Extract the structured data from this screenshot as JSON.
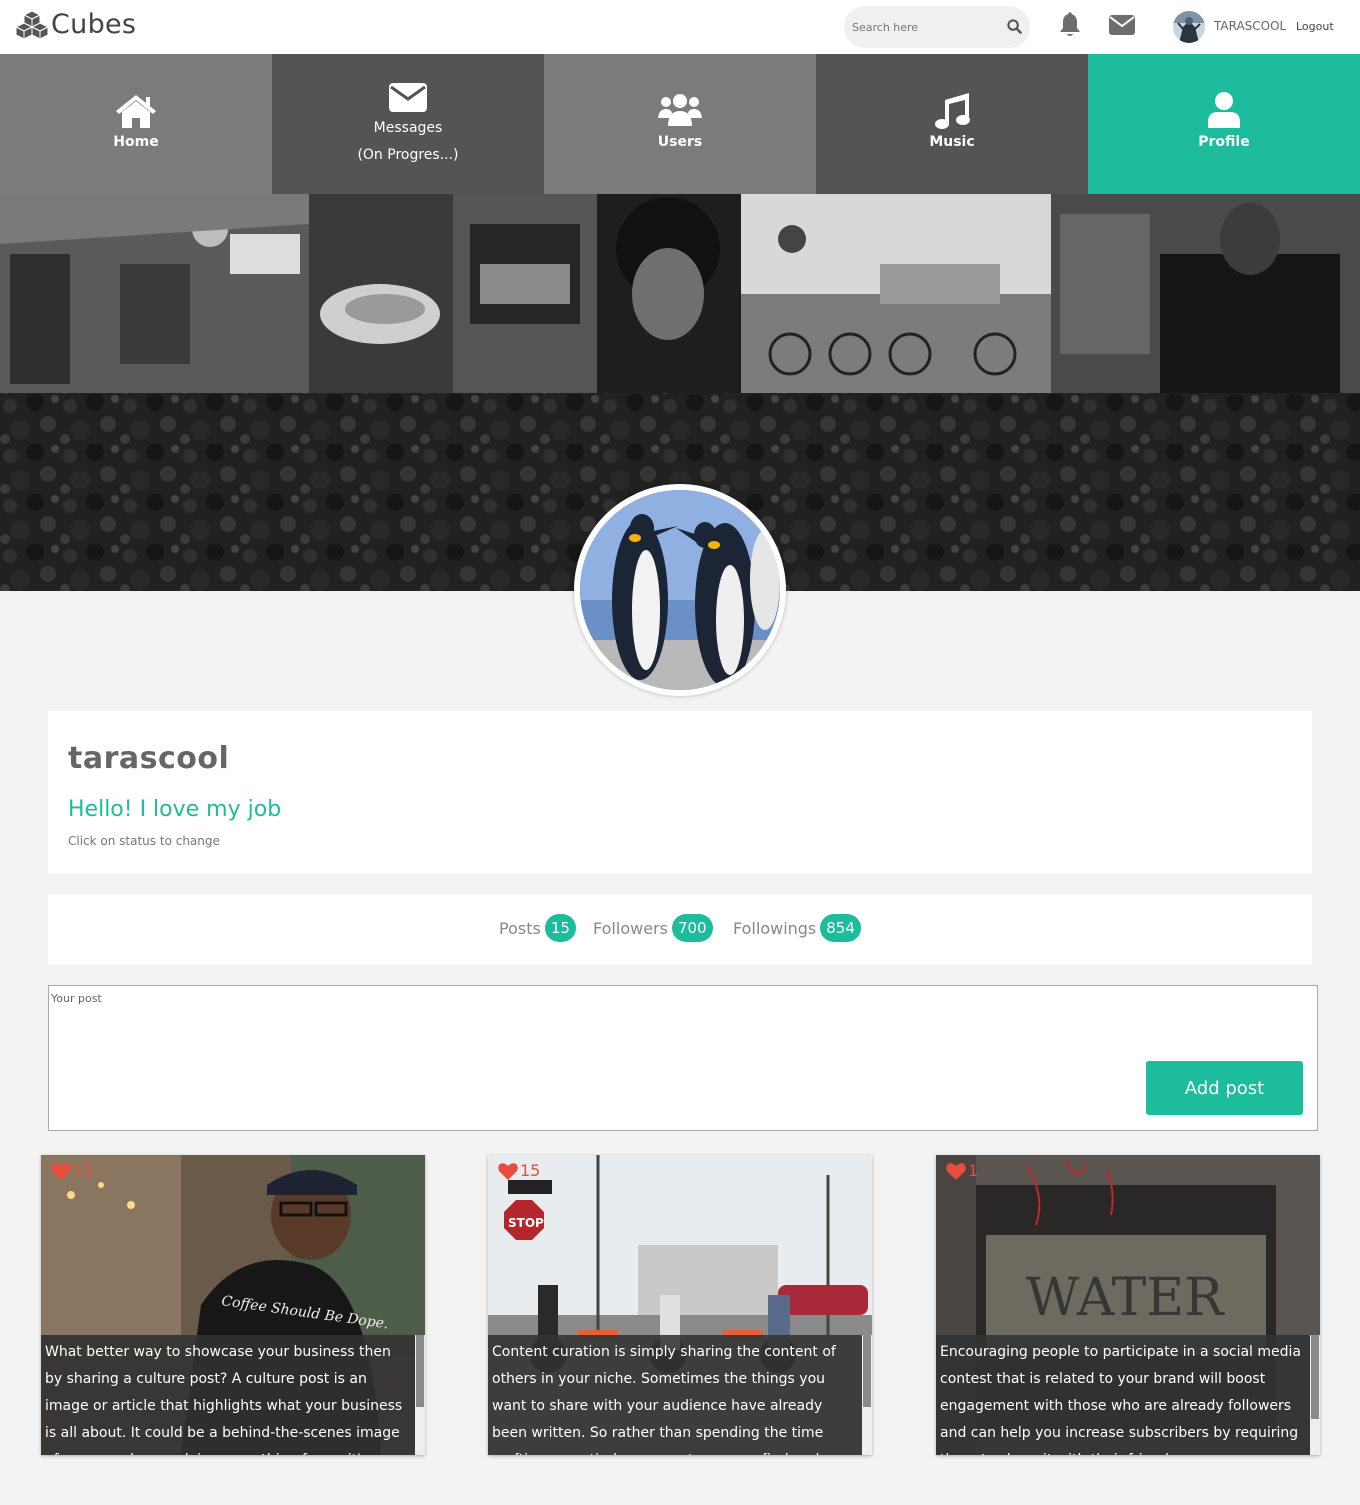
{
  "app": {
    "name": "Cubes"
  },
  "header": {
    "search_placeholder": "Search here",
    "username": "TARASCOOL",
    "logout_label": "Logout"
  },
  "nav": [
    {
      "label": "Home",
      "sub": "",
      "icon": "home-icon",
      "color": "#7b7b7b",
      "active": false
    },
    {
      "label": "Messages",
      "sub": "(On Progres...)",
      "icon": "envelope-icon",
      "color": "#545454",
      "active": false
    },
    {
      "label": "Users",
      "sub": "",
      "icon": "users-icon",
      "color": "#7b7b7b",
      "active": false
    },
    {
      "label": "Music",
      "sub": "",
      "icon": "music-icon",
      "color": "#545454",
      "active": false
    },
    {
      "label": "Profile",
      "sub": "",
      "icon": "user-icon",
      "color": "#1cbc9c",
      "active": true
    }
  ],
  "profile": {
    "username": "tarascool",
    "status": "Hello! I love my job",
    "status_hint": "Click on status to change"
  },
  "stats": {
    "posts_label": "Posts",
    "posts": "15",
    "followers_label": "Followers",
    "followers": "700",
    "followings_label": "Followings",
    "followings": "854"
  },
  "composer": {
    "placeholder": "Your post",
    "button": "Add post"
  },
  "posts": [
    {
      "likes": "12",
      "text": "What better way to showcase your business then by sharing a culture post? A culture post is an image or article that highlights what your business is all about. It could be a behind-the-scenes image of your employees doing something fun or it's a great way to humanize your brand."
    },
    {
      "likes": "15",
      "text": "Content curation is simply sharing the content of others in your niche. Sometimes the things you want to share with your audience have already been written. So rather than spending the time crafting an entirely new post, you can find and share existing content."
    },
    {
      "likes": "1",
      "text": "Encouraging people to participate in a social media contest that is related to your brand will boost engagement with those who are already followers and can help you increase subscribers by requiring them to share it with their friends."
    }
  ],
  "colors": {
    "accent": "#1cbc9c",
    "heart": "#e74c3c"
  }
}
